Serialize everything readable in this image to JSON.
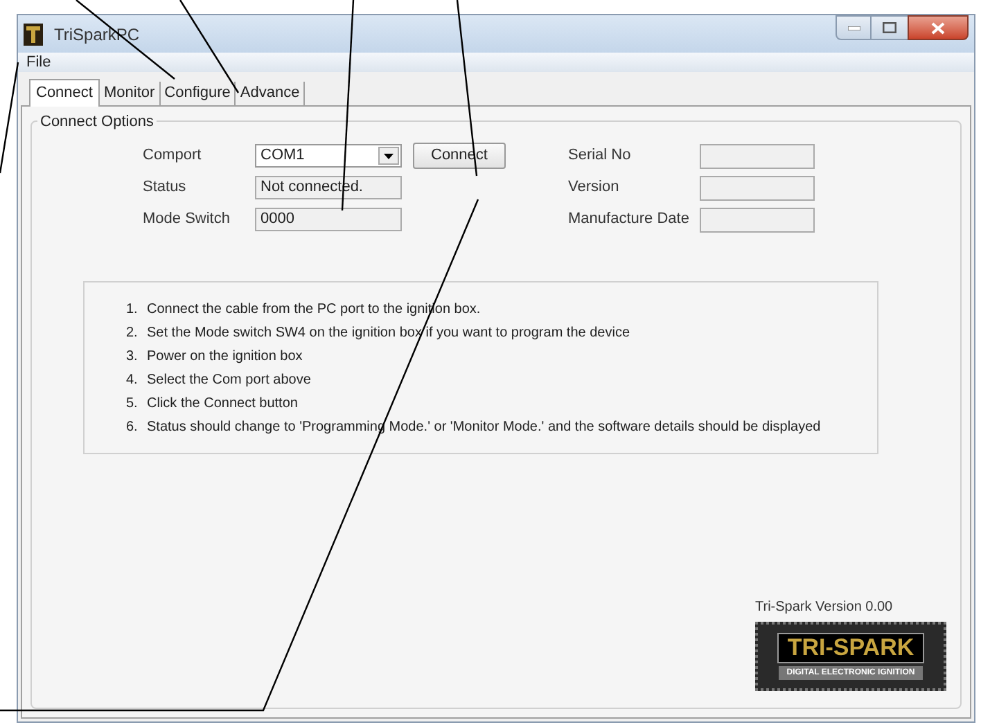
{
  "window": {
    "title": "TriSparkPC"
  },
  "menu": [
    "File"
  ],
  "tabs": [
    {
      "label": "Connect",
      "selected": true
    },
    {
      "label": "Monitor",
      "selected": false
    },
    {
      "label": "Configure",
      "selected": false
    },
    {
      "label": "Advance",
      "selected": false
    }
  ],
  "group": {
    "title": "Connect Options"
  },
  "left_fields": [
    {
      "label": "Comport",
      "value": "COM1",
      "kind": "dropdown"
    },
    {
      "label": "Status",
      "value": "Not connected.",
      "kind": "readonly"
    },
    {
      "label": "Mode Switch",
      "value": "0000",
      "kind": "readonly"
    }
  ],
  "connect_button": "Connect",
  "right_fields": [
    {
      "label": "Serial No"
    },
    {
      "label": "Version"
    },
    {
      "label": "Manufacture Date"
    }
  ],
  "instructions": [
    {
      "number": "1.",
      "text": "Connect the cable from the PC port to the ignition box."
    },
    {
      "number": "2.",
      "text": "Set the Mode switch SW4 on the ignition box if you want to program the device"
    },
    {
      "number": "3.",
      "text": "Power on the ignition box"
    },
    {
      "number": "4.",
      "text": "Select the Com port above"
    },
    {
      "number": "5.",
      "text": "Click the Connect button"
    },
    {
      "number": "6.",
      "text": "Status should change to 'Programming Mode.' or 'Monitor Mode.' and the software details should be displayed"
    }
  ],
  "version": "Tri-Spark Version 0.00",
  "logo": {
    "title": "TRI-SPARK",
    "subtitle": "DIGITAL ELECTRONIC IGNITION"
  }
}
